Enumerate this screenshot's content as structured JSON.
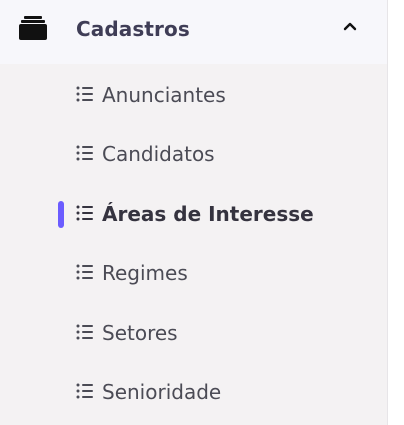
{
  "sidebar": {
    "section": {
      "title": "Cadastros",
      "icon": "briefcase-icon",
      "expanded": true,
      "chevron_icon": "chevron-up-icon"
    },
    "items": [
      {
        "label": "Anunciantes",
        "icon": "list-icon",
        "active": false
      },
      {
        "label": "Candidatos",
        "icon": "list-icon",
        "active": false
      },
      {
        "label": "Áreas de Interesse",
        "icon": "list-icon",
        "active": true
      },
      {
        "label": "Regimes",
        "icon": "list-icon",
        "active": false
      },
      {
        "label": "Setores",
        "icon": "list-icon",
        "active": false
      },
      {
        "label": "Senioridade",
        "icon": "list-icon",
        "active": false
      }
    ]
  },
  "colors": {
    "sidebar_background": "#f4f2f3",
    "section_header_background": "#f7f7fb",
    "text_primary": "#3f3d56",
    "active_marker": "#6b5cff"
  }
}
